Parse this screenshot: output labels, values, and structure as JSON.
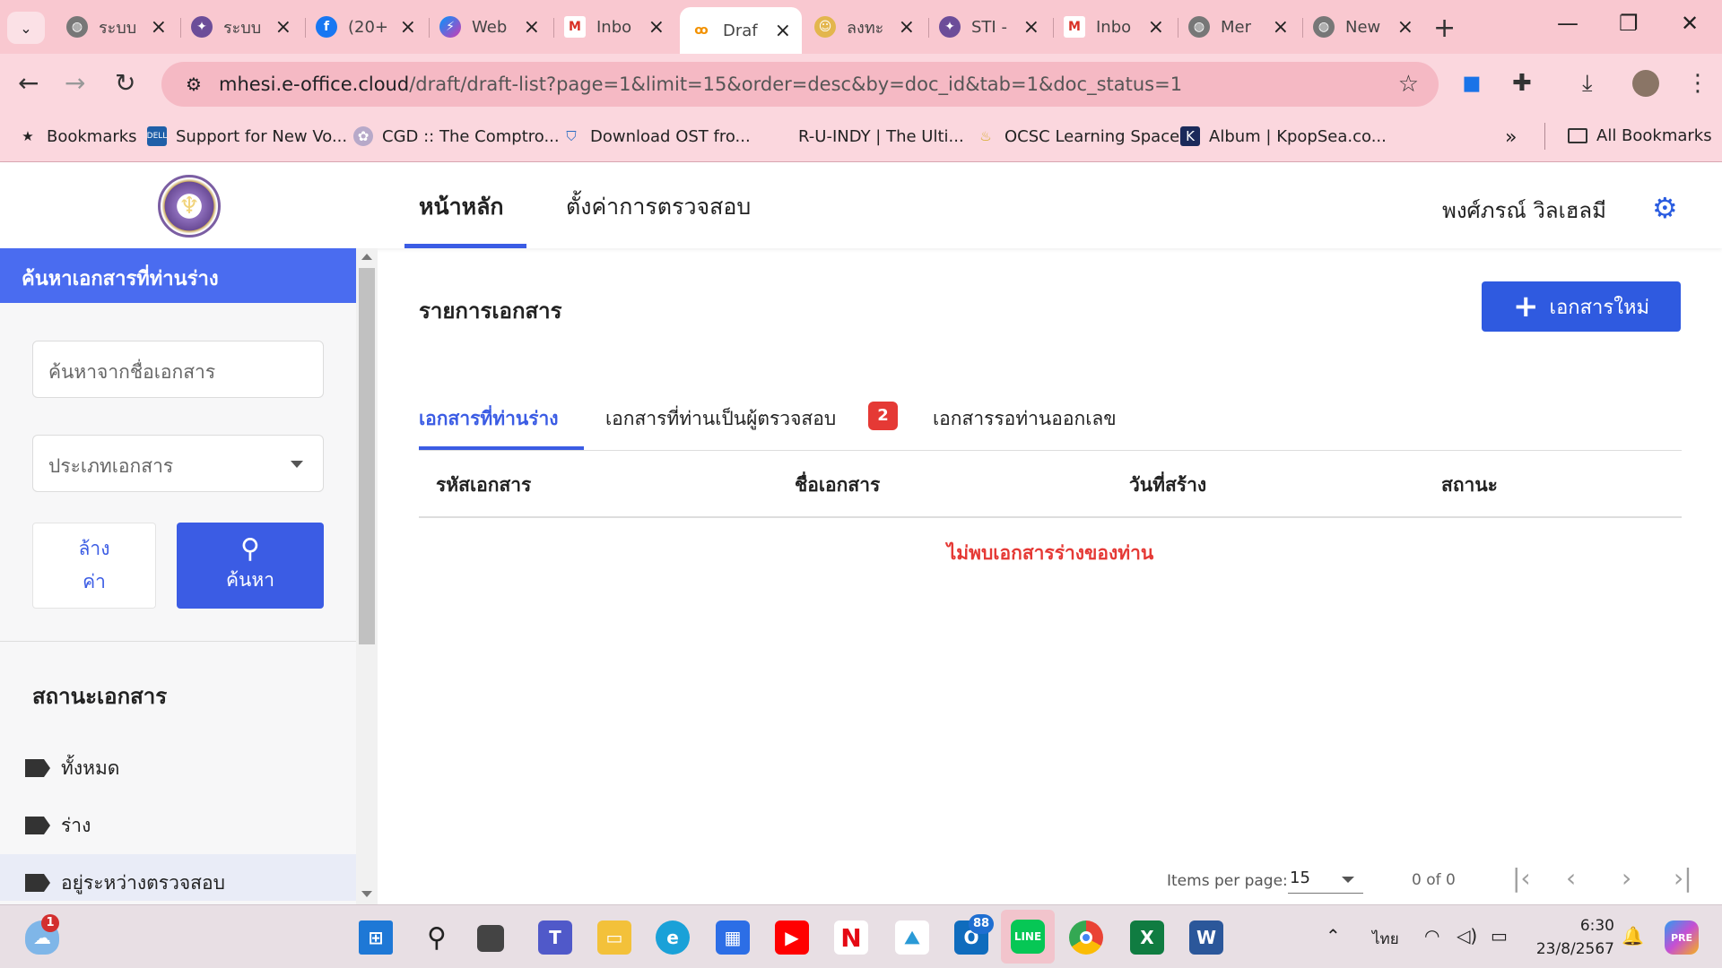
{
  "browser": {
    "tabs": [
      {
        "title": "ระบบ",
        "icon": "globe-icon",
        "active": false
      },
      {
        "title": "ระบบ",
        "icon": "seal-icon",
        "active": false
      },
      {
        "title": "(20+",
        "icon": "facebook-icon",
        "active": false
      },
      {
        "title": "Web",
        "icon": "messenger-icon",
        "active": false
      },
      {
        "title": "Inbo",
        "icon": "gmail-icon",
        "active": false
      },
      {
        "title": "Draf",
        "icon": "eoffice-icon",
        "active": true
      },
      {
        "title": "ลงทะ",
        "icon": "people-icon",
        "active": false
      },
      {
        "title": "STI -",
        "icon": "seal-icon",
        "active": false
      },
      {
        "title": "Inbo",
        "icon": "gmail-icon",
        "active": false
      },
      {
        "title": "Mer",
        "icon": "globe-icon",
        "active": false
      },
      {
        "title": "New",
        "icon": "globe-icon",
        "active": false
      }
    ],
    "url_host": "mhesi.e-office.cloud",
    "url_path": "/draft/draft-list?page=1&limit=15&order=desc&by=doc_id&tab=1&doc_status=1",
    "bookmarks": [
      {
        "label": "Bookmarks",
        "icon": "star-icon"
      },
      {
        "label": "Support for New Vo...",
        "icon": "dell-icon"
      },
      {
        "label": "CGD :: The Comptro...",
        "icon": "cgd-icon"
      },
      {
        "label": "Download OST fro...",
        "icon": "shield-icon"
      },
      {
        "label": "R-U-INDY | The Ulti...",
        "icon": ""
      },
      {
        "label": "OCSC Learning Space",
        "icon": "ocsc-icon"
      },
      {
        "label": "Album | KpopSea.co...",
        "icon": "kpopsea-icon"
      }
    ],
    "more_bookmarks": "»",
    "all_bookmarks": "All Bookmarks"
  },
  "app": {
    "nav": [
      {
        "label": "หน้าหลัก",
        "active": true
      },
      {
        "label": "ตั้งค่าการตรวจสอบ",
        "active": false
      }
    ],
    "user_name": "พงศ์ภรณ์ วิลเฮลมี"
  },
  "sidebar": {
    "header": "ค้นหาเอกสารที่ท่านร่าง",
    "search_placeholder": "ค้นหาจากชื่อเอกสาร",
    "type_placeholder": "ประเภทเอกสาร",
    "clear_label_1": "ล้าง",
    "clear_label_2": "ค่า",
    "search_label": "ค้นหา",
    "status_title": "สถานะเอกสาร",
    "status_items": [
      {
        "label": "ทั้งหมด",
        "highlighted": false
      },
      {
        "label": "ร่าง",
        "highlighted": false
      },
      {
        "label": "อยู่ระหว่างตรวจสอบ",
        "highlighted": true
      }
    ]
  },
  "main": {
    "title": "รายการเอกสาร",
    "new_button": "เอกสารใหม่",
    "tabs": [
      {
        "label": "เอกสารที่ท่านร่าง",
        "active": true
      },
      {
        "label": "เอกสารที่ท่านเป็นผู้ตรวจสอบ",
        "active": false,
        "badge": "2"
      },
      {
        "label": "เอกสารรอท่านออกเลข",
        "active": false
      }
    ],
    "columns": [
      "รหัสเอกสาร",
      "ชื่อเอกสาร",
      "วันที่สร้าง",
      "สถานะ"
    ],
    "empty_message": "ไม่พบเอกสารร่างของท่าน",
    "pager": {
      "items_per_page_label": "Items per page:",
      "items_per_page": "15",
      "range": "0 of 0"
    }
  },
  "taskbar": {
    "weather_badge": "1",
    "outlook_badge": "88",
    "language": "ไทย",
    "time": "6:30",
    "date": "23/8/2567"
  },
  "colors": {
    "accent": "#3b5ce4",
    "sidebar_header": "#4a6cf0",
    "error": "#e53935",
    "browser_frame": "#f9c8d0"
  }
}
